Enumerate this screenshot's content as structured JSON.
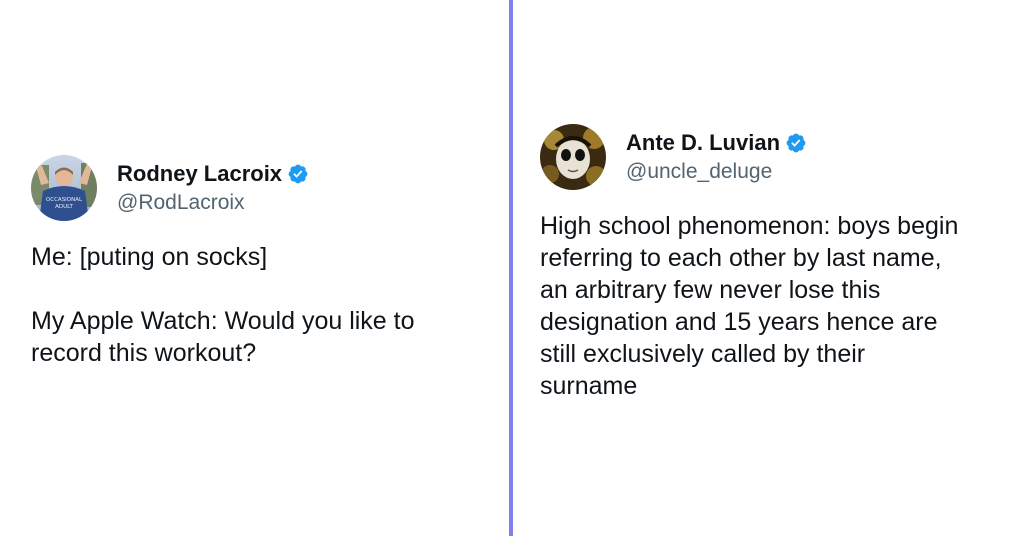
{
  "colors": {
    "divider": "#7f7ff0",
    "verified": "#1d9bf0",
    "handle": "#536471",
    "text": "#0f1419"
  },
  "tweets": [
    {
      "display_name": "Rodney Lacroix",
      "handle": "@RodLacroix",
      "verified_icon": "verified-badge-icon",
      "avatar_shirt_text": "OCCASIONAL ADULT",
      "text": "Me: [puting on socks]\n\nMy Apple Watch: Would you like to\nrecord this workout?"
    },
    {
      "display_name": "Ante D. Luvian",
      "handle": "@uncle_deluge",
      "verified_icon": "verified-badge-icon",
      "text": "High school phenomenon: boys begin\nreferring to each other by last name,\nan arbitrary few never lose this\ndesignation and 15 years hence are\nstill exclusively called by their\nsurname"
    }
  ]
}
